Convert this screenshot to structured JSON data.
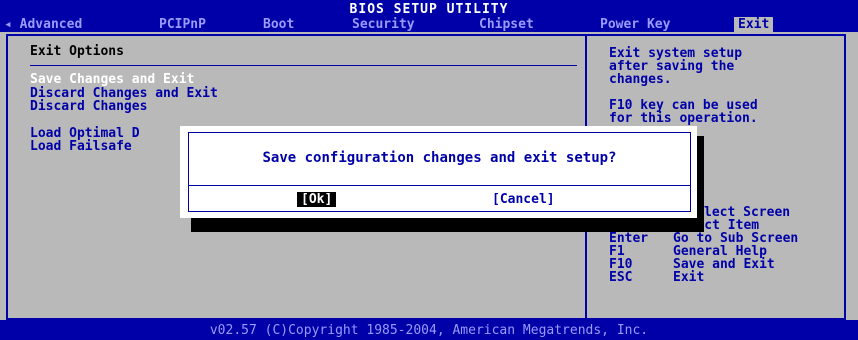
{
  "title": "BIOS SETUP UTILITY",
  "tabs": [
    {
      "label": "◂ Advanced"
    },
    {
      "label": "PCIPnP"
    },
    {
      "label": "Boot"
    },
    {
      "label": "Security"
    },
    {
      "label": "Chipset"
    },
    {
      "label": "Power Key"
    },
    {
      "label": "Exit"
    }
  ],
  "active_tab": "Exit",
  "left_panel": {
    "heading": "Exit Options",
    "options": [
      {
        "label": "Save Changes and Exit"
      },
      {
        "label": "Discard Changes and Exit"
      },
      {
        "label": "Discard Changes"
      },
      {
        "label": "Load Optimal D"
      },
      {
        "label": "Load Failsafe"
      }
    ]
  },
  "help": {
    "lines": [
      "Exit system setup",
      "after saving the",
      "changes.",
      "F10 key can be used",
      "for this operation."
    ],
    "keys": [
      {
        "key": "",
        "desc": "lect Screen"
      },
      {
        "key": "↑↓",
        "desc": "Select Item"
      },
      {
        "key": "Enter",
        "desc": "Go to Sub Screen"
      },
      {
        "key": "F1",
        "desc": "General Help"
      },
      {
        "key": "F10",
        "desc": "Save and Exit"
      },
      {
        "key": "ESC",
        "desc": "Exit"
      }
    ]
  },
  "dialog": {
    "message": "Save configuration changes and exit setup?",
    "ok_label": "[Ok]",
    "cancel_label": "[Cancel]"
  },
  "footer": "v02.57 (C)Copyright 1985-2004, American Megatrends, Inc.",
  "colors": {
    "bios_blue": "#0000a8",
    "panel_gray": "#b9b9b9",
    "inactive_tab": "#9a9aff",
    "white": "#ffffff"
  }
}
